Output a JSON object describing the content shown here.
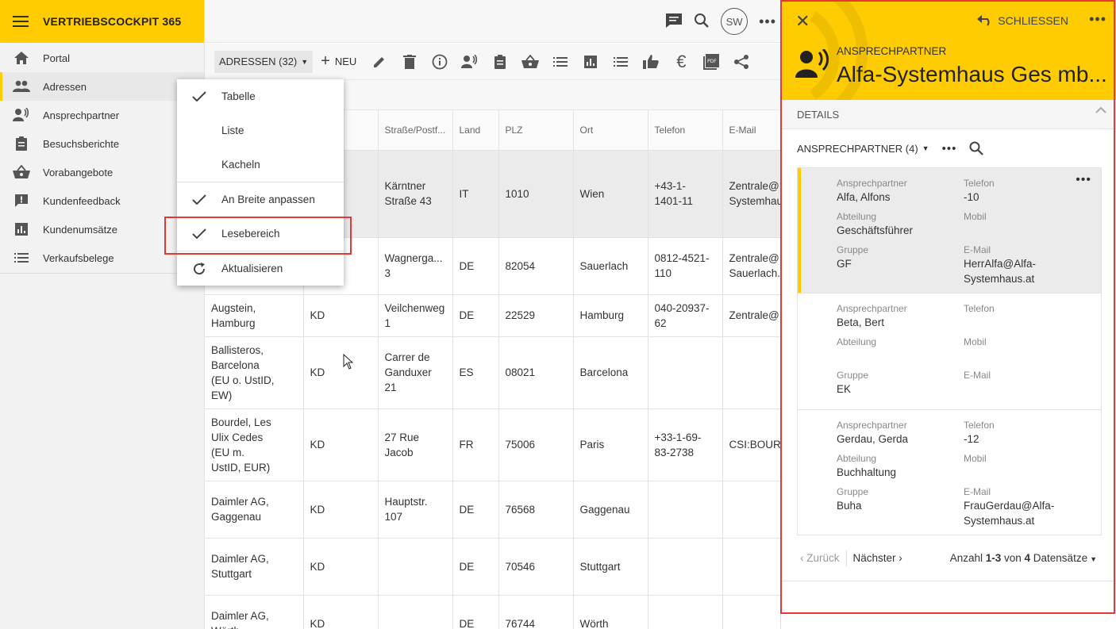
{
  "app": {
    "title": "VERTRIEBSCOCKPIT 365",
    "user_initials": "SW"
  },
  "sidebar": {
    "items": [
      {
        "label": "Portal",
        "icon": "home-icon",
        "active": false
      },
      {
        "label": "Adressen",
        "icon": "people-icon",
        "active": true
      },
      {
        "label": "Ansprechpartner",
        "icon": "contact-voice-icon",
        "active": false
      },
      {
        "label": "Besuchsberichte",
        "icon": "clipboard-icon",
        "active": false
      },
      {
        "label": "Vorabangebote",
        "icon": "basket-icon",
        "active": false
      },
      {
        "label": "Kundenfeedback",
        "icon": "feedback-icon",
        "active": false
      },
      {
        "label": "Kundenumsätze",
        "icon": "bar-chart-icon",
        "active": false
      },
      {
        "label": "Verkaufsbelege",
        "icon": "list-icon",
        "active": false
      }
    ]
  },
  "toolbar": {
    "view_label": "ADRESSEN (32)",
    "new_label": "NEU"
  },
  "menu": {
    "items": [
      {
        "label": "Tabelle",
        "checked": true
      },
      {
        "label": "Liste",
        "checked": false
      },
      {
        "label": "Kacheln",
        "checked": false
      },
      {
        "label": "An Breite anpassen",
        "checked": true
      },
      {
        "label": "Lesebereich",
        "checked": true
      },
      {
        "label": "Aktualisieren",
        "checked": false
      }
    ]
  },
  "table": {
    "columns": [
      "",
      "",
      "Straße/Postf...",
      "Land",
      "PLZ",
      "Ort",
      "Telefon",
      "E-Mail"
    ],
    "rows": [
      {
        "name": "",
        "type": "",
        "street": "Kärntner\nStraße 43",
        "country": "IT",
        "zip": "1010",
        "city": "Wien",
        "phone": "+43-1-\n1401-11",
        "email": "Zentrale@\nSystemhau",
        "selected": true
      },
      {
        "name": "",
        "type": "",
        "street": "Wagnerga...\n3",
        "country": "DE",
        "zip": "82054",
        "city": "Sauerlach",
        "phone": "0812-4521-\n110",
        "email": "Zentrale@\nSauerlach.",
        "selected": false
      },
      {
        "name": "Augstein,\nHamburg",
        "type": "KD",
        "street": "Veilchenweg\n1",
        "country": "DE",
        "zip": "22529",
        "city": "Hamburg",
        "phone": "040-20937-\n62",
        "email": "Zentrale@",
        "selected": false
      },
      {
        "name": "Ballisteros,\nBarcelona\n(EU o. UstID,\nEW)",
        "type": "KD",
        "street": "Carrer de\nGanduxer\n21",
        "country": "ES",
        "zip": "08021",
        "city": "Barcelona",
        "phone": "",
        "email": "",
        "selected": false
      },
      {
        "name": "Bourdel, Les\nUlix Cedes\n(EU m.\nUstID, EUR)",
        "type": "KD",
        "street": "27 Rue\nJacob",
        "country": "FR",
        "zip": "75006",
        "city": "Paris",
        "phone": "+33-1-69-\n83-2738",
        "email": "CSI:BOUR...",
        "selected": false
      },
      {
        "name": "Daimler AG,\nGaggenau",
        "type": "KD",
        "street": "Hauptstr.\n107",
        "country": "DE",
        "zip": "76568",
        "city": "Gaggenau",
        "phone": "",
        "email": "",
        "selected": false
      },
      {
        "name": "Daimler AG,\nStuttgart",
        "type": "KD",
        "street": "",
        "country": "DE",
        "zip": "70546",
        "city": "Stuttgart",
        "phone": "",
        "email": "",
        "selected": false
      },
      {
        "name": "Daimler AG,\nWörth",
        "type": "KD",
        "street": "",
        "country": "DE",
        "zip": "76744",
        "city": "Wörth",
        "phone": "",
        "email": "",
        "selected": false
      }
    ]
  },
  "panel": {
    "close_label": "SCHLIESSEN",
    "eyebrow": "ANSPRECHPARTNER",
    "title": "Alfa-Systemhaus Ges mb...",
    "details_label": "DETAILS",
    "sub_label": "ANSPRECHPARTNER (4)",
    "labels": {
      "contact": "Ansprechpartner",
      "phone": "Telefon",
      "dept": "Abteilung",
      "mobile": "Mobil",
      "group": "Gruppe",
      "email": "E-Mail"
    },
    "cards": [
      {
        "contact": "Alfa, Alfons",
        "phone": "-10",
        "dept": "Geschäftsführer",
        "mobile": "",
        "group": "GF",
        "email": "HerrAlfa@Alfa-\nSystemhaus.at",
        "selected": true
      },
      {
        "contact": "Beta, Bert",
        "phone": "",
        "dept": "",
        "mobile": "",
        "group": "EK",
        "email": "",
        "selected": false
      },
      {
        "contact": "Gerdau, Gerda",
        "phone": "-12",
        "dept": "Buchhaltung",
        "mobile": "",
        "group": "Buha",
        "email": "FrauGerdau@Alfa-\nSystemhaus.at",
        "selected": false
      }
    ],
    "pager": {
      "back": "Zurück",
      "next": "Nächster",
      "count_prefix": "Anzahl ",
      "count_range": "1-3",
      "count_mid": " von ",
      "count_total": "4",
      "count_suffix": " Datensätze"
    }
  },
  "colors": {
    "accent": "#fecc00",
    "highlight": "#e53935"
  }
}
